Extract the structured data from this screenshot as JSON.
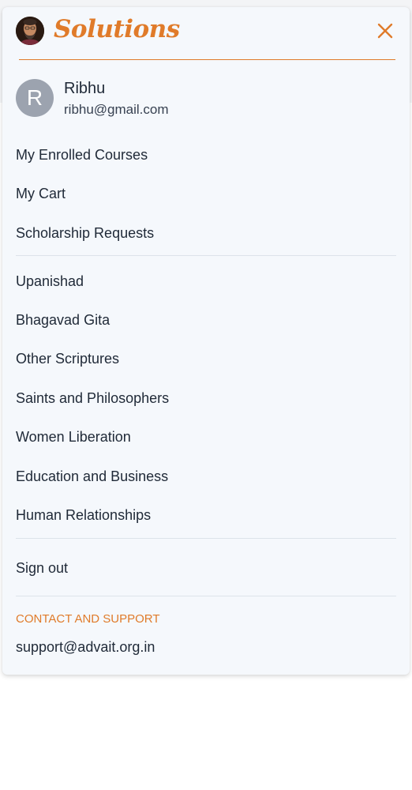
{
  "brand": {
    "name": "Solutions",
    "accent_color": "#e07b2a",
    "logo_icon": "teacher-portrait-avatar"
  },
  "header": {
    "close_icon": "close-icon"
  },
  "user": {
    "initial": "R",
    "name": "Ribhu",
    "email": "ribhu@gmail.com"
  },
  "account_menu": [
    {
      "label": "My Enrolled Courses"
    },
    {
      "label": "My Cart"
    },
    {
      "label": "Scholarship Requests"
    }
  ],
  "category_menu": [
    {
      "label": "Upanishad"
    },
    {
      "label": "Bhagavad Gita"
    },
    {
      "label": "Other Scriptures"
    },
    {
      "label": "Saints and Philosophers"
    },
    {
      "label": "Women Liberation"
    },
    {
      "label": "Education and Business"
    },
    {
      "label": "Human Relationships"
    }
  ],
  "sign_out": {
    "label": "Sign out"
  },
  "contact": {
    "heading": "CONTACT AND SUPPORT",
    "email": "support@advait.org.in"
  }
}
